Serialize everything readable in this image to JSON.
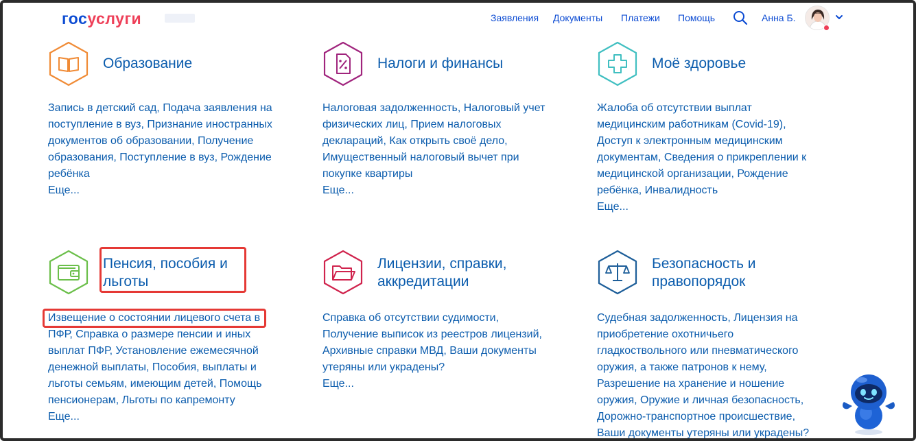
{
  "header": {
    "logo": {
      "part1": "гос",
      "part2": "услуги"
    },
    "nav": [
      "Заявления",
      "Документы",
      "Платежи",
      "Помощь"
    ],
    "user_name": "Анна Б."
  },
  "categories": [
    {
      "title": "Образование",
      "icon": "book-icon",
      "color": "#f08b36",
      "links": "Запись в детский сад, Подача заявления на поступление в вуз, Признание иностранных документов об образовании, Получение образования, Поступление в вуз, Рождение ребёнка",
      "more": "Еще..."
    },
    {
      "title": "Налоги и финансы",
      "icon": "tax-document-icon",
      "color": "#a0247d",
      "links": "Налоговая задолженность, Налоговый учет физических лиц, Прием налоговых деклараций, Как открыть своё дело, Имущественный налоговый вычет при покупке квартиры",
      "more": "Еще..."
    },
    {
      "title": "Моё здоровье",
      "icon": "medical-cross-icon",
      "color": "#40bfc1",
      "links": "Жалоба об отсутствии выплат медицинским работникам (Covid-19), Доступ к электронным медицинским документам, Сведения о прикреплении к медицинской организации, Рождение ребёнка, Инвалидность",
      "more": "Еще..."
    },
    {
      "title": "Пенсия, пособия и льготы",
      "icon": "wallet-icon",
      "color": "#6bbf4a",
      "links": "Извещение о состоянии лицевого счета в ПФР, Справка о размере пенсии и иных выплат ПФР, Установление ежемесячной денежной выплаты, Пособия, выплаты и льготы семьям, имеющим детей, Помощь пенсионерам, Льготы по капремонту",
      "more": "Еще..."
    },
    {
      "title": "Лицензии, справки, аккредитации",
      "icon": "folder-icon",
      "color": "#d0234d",
      "links": "Справка об отсутствии судимости, Получение выписок из реестров лицензий, Архивные справки МВД, Ваши документы утеряны или украдены?",
      "more": "Еще..."
    },
    {
      "title": "Безопасность и правопорядок",
      "icon": "scales-icon",
      "color": "#1d5e99",
      "links": "Судебная задолженность, Лицензия на приобретение охотничьего гладкоствольного или пневматического оружия, а также патронов к нему, Разрешение на хранение и ношение оружия, Оружие и личная безопасность, Дорожно-транспортное происшествие, Ваши документы утеряны или украдены?",
      "more": ""
    }
  ],
  "colors": {
    "link": "#0b5cad",
    "highlight": "#e53935",
    "brand_blue": "#0d4cd3",
    "brand_red": "#ee3f58"
  }
}
